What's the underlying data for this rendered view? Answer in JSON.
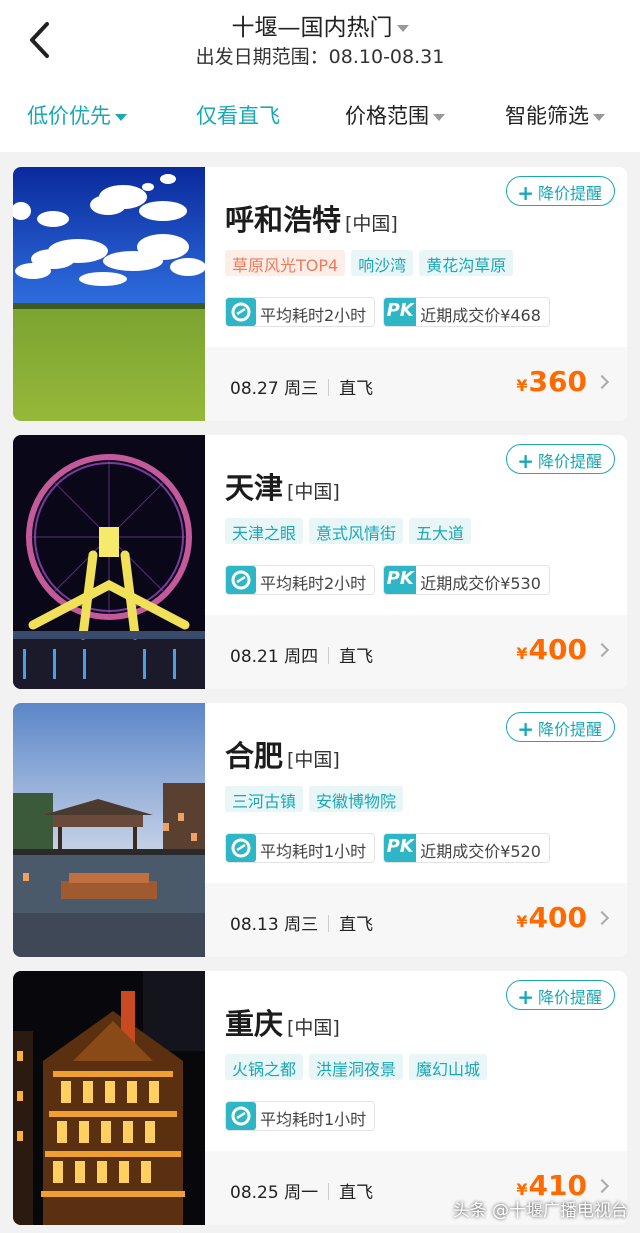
{
  "header": {
    "title": "十堰—国内热门",
    "date_range": "出发日期范围：08.10-08.31"
  },
  "filters": [
    {
      "label": "低价优先",
      "state": "active"
    },
    {
      "label": "仅看直飞"
    },
    {
      "label": "价格范围"
    },
    {
      "label": "智能筛选"
    }
  ],
  "alert_label": "降价提醒",
  "cards": [
    {
      "city": "呼和浩特",
      "country": "[中国]",
      "tags": [
        "草原风光TOP4",
        "响沙湾",
        "黄花沟草原"
      ],
      "duration": "平均耗时2小时",
      "recent_price": "近期成交价¥468",
      "date": "08.27 周三",
      "flight_type": "直飞",
      "currency": "¥",
      "price": "360",
      "image": "grassland-landscape"
    },
    {
      "city": "天津",
      "country": "[中国]",
      "tags": [
        "天津之眼",
        "意式风情街",
        "五大道"
      ],
      "duration": "平均耗时2小时",
      "recent_price": "近期成交价¥530",
      "date": "08.21 周四",
      "flight_type": "直飞",
      "currency": "¥",
      "price": "400",
      "image": "ferris-wheel-night"
    },
    {
      "city": "合肥",
      "country": "[中国]",
      "tags": [
        "三河古镇",
        "安徽博物院"
      ],
      "duration": "平均耗时1小时",
      "recent_price": "近期成交价¥520",
      "date": "08.13 周三",
      "flight_type": "直飞",
      "currency": "¥",
      "price": "400",
      "image": "ancient-town-river"
    },
    {
      "city": "重庆",
      "country": "[中国]",
      "tags": [
        "火锅之都",
        "洪崖洞夜景",
        "魔幻山城"
      ],
      "duration": "平均耗时1小时",
      "date": "08.25 周一",
      "flight_type": "直飞",
      "currency": "¥",
      "price": "410",
      "image": "night-building"
    }
  ],
  "watermark": "头条 @十堰广播电视台",
  "colors": {
    "accent": "#1aa8b5",
    "price": "#ff6a00",
    "rank_tag": "#f07a5a"
  }
}
